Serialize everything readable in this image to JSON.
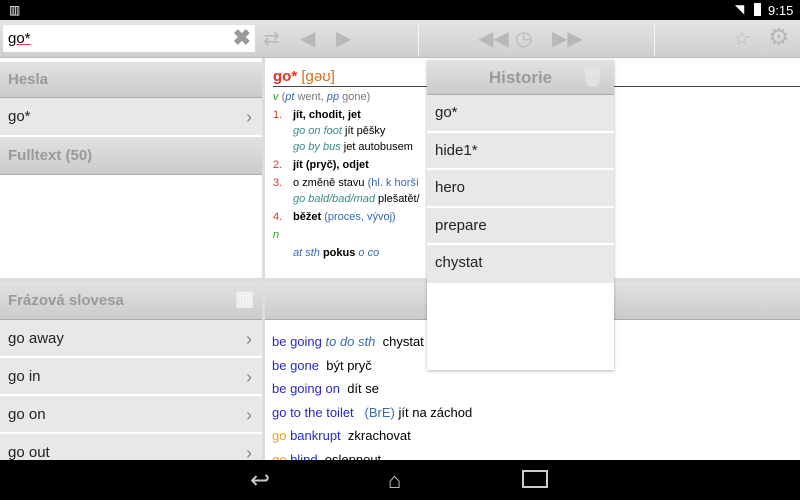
{
  "status": {
    "time": "9:15"
  },
  "toolbar": {
    "search_value": "go*"
  },
  "left": {
    "hesla_header": "Hesla",
    "hesla_items": [
      "go*"
    ],
    "fulltext_header": "Fulltext (50)",
    "phrasal_header": "Frázová slovesa",
    "phrasal_items": [
      "go away",
      "go in",
      "go on",
      "go out"
    ]
  },
  "entry": {
    "headword": "go*",
    "pron": "[gəʊ]",
    "pos_v": "v",
    "pt": "pt",
    "went": " went, ",
    "pp": "pp",
    "gone": " gone)",
    "open": "(",
    "senses": [
      {
        "num": "1.",
        "text": "jít, chodit, jet"
      },
      {
        "num": "2.",
        "text": "jít (pryč), odjet"
      },
      {
        "num": "3.",
        "text": "o změně stavu",
        "note": "(hl. k horší"
      },
      {
        "num": "4.",
        "text": "běžet",
        "note": "(proces, vývoj)"
      }
    ],
    "ex1a": "go on foot",
    "ex1a_tr": " jít pěšky",
    "ex1b": "go by bus",
    "ex1b_tr": " jet autobusem",
    "ex3": "go bald/bad/mad",
    "ex3_tr": " plešatět/",
    "pos_n": "n",
    "n_a": "at sth",
    "n_b": " pokus ",
    "n_c": "o co"
  },
  "history": {
    "title": "Historie",
    "items": [
      "go*",
      "hide1*",
      "hero",
      "prepare",
      "chystat"
    ]
  },
  "phrases": [
    {
      "a": "be going ",
      "b": "to do sth",
      "tr": "chystat"
    },
    {
      "a": "be gone",
      "tr": "být pryč"
    },
    {
      "a": "be going on",
      "tr": "dít se"
    },
    {
      "a": "go to the toilet",
      "b": "(BrE)",
      "tr": "jít na záchod"
    },
    {
      "o": "go ",
      "a": "bankrupt",
      "tr": "zkrachovat"
    },
    {
      "o": "go ",
      "a": "blind",
      "tr": "oslepnout"
    }
  ]
}
